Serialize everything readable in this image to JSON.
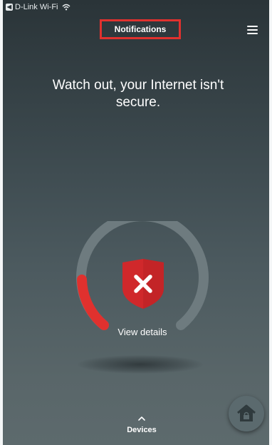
{
  "status_bar": {
    "back_label": "D-Link Wi-Fi"
  },
  "header": {
    "title": "Notifications",
    "menu_icon": "hamburger-menu-icon"
  },
  "main": {
    "headline": "Watch out, your Internet isn't secure.",
    "security_status_icon": "shield-x-icon",
    "view_details_label": "View details"
  },
  "bottom": {
    "devices_label": "Devices",
    "chevron_icon": "chevron-up-icon",
    "fab_icon": "house-lock-icon"
  },
  "colors": {
    "alert_red": "#e0312e",
    "shield_red": "#d0282b",
    "gauge_track": "#6e7b7f",
    "background_top": "#2a3438",
    "background_bottom": "#5d6a6d"
  }
}
